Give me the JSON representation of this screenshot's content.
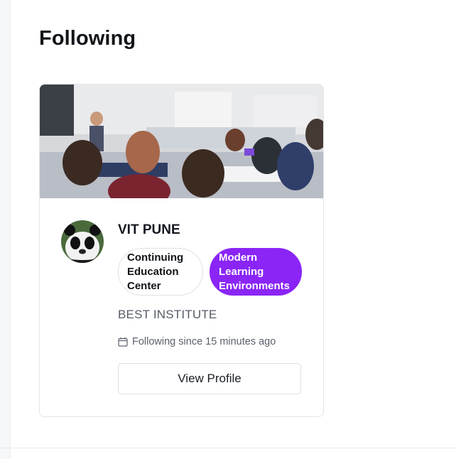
{
  "page": {
    "title": "Following"
  },
  "card": {
    "name": "VIT PUNE",
    "tags": [
      {
        "label": "Continuing Education Center",
        "style": "outline"
      },
      {
        "label": "Modern Learning Environments",
        "style": "filled",
        "color": "#8a25f6"
      }
    ],
    "description": "BEST INSTITUTE",
    "following_since": "Following since 15 minutes ago",
    "following_icon": "calendar-icon",
    "view_profile_label": "View Profile"
  },
  "colors": {
    "accent": "#8a25f6",
    "text_primary": "#111418",
    "text_secondary": "#555b66",
    "border": "#e3e5e8"
  }
}
